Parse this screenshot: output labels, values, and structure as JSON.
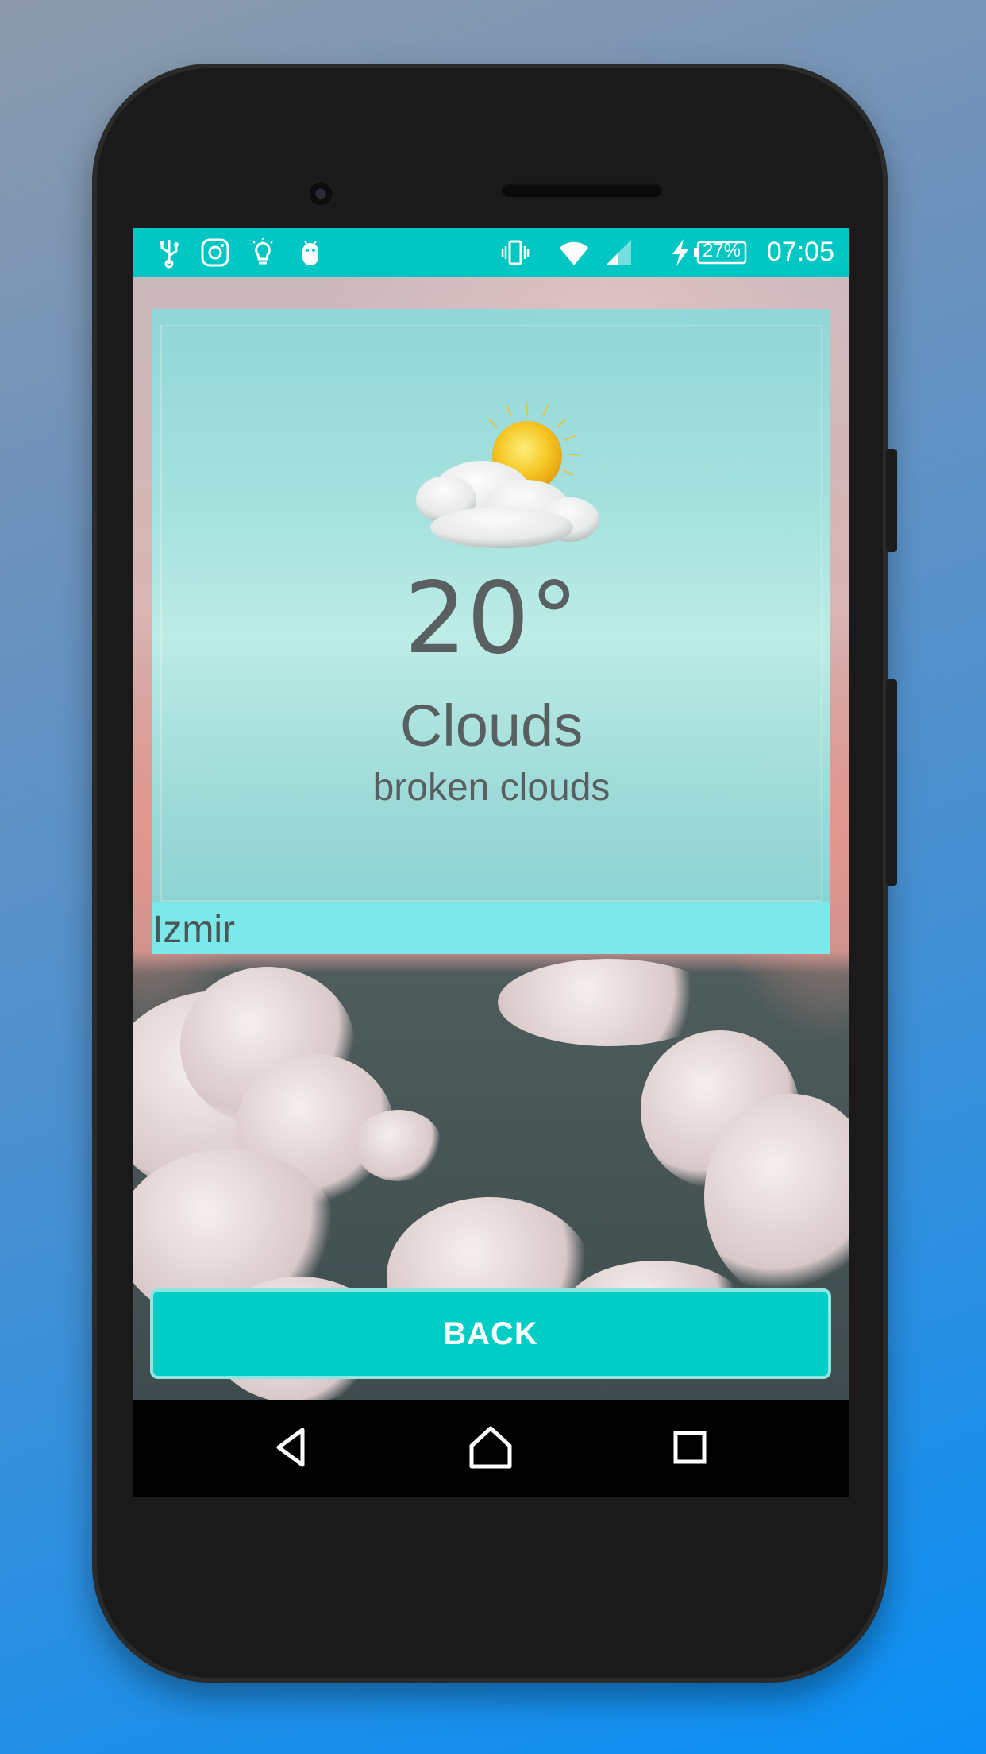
{
  "status_bar": {
    "battery_percent": "27%",
    "time": "07:05",
    "left_icons": [
      "usb-icon",
      "instagram-icon",
      "lightbulb-icon",
      "android-debug-icon"
    ],
    "right_icons": [
      "vibrate-icon",
      "wifi-icon",
      "signal-icon",
      "charging-icon",
      "battery-icon"
    ]
  },
  "weather": {
    "icon": "partly-cloudy-icon",
    "temperature": "20°",
    "main": "Clouds",
    "description": "broken clouds",
    "city": "Izmir"
  },
  "actions": {
    "back_label": "BACK"
  },
  "colors": {
    "accent": "#00c7c3",
    "card": "#a5e4e0",
    "text": "#555d5e"
  }
}
